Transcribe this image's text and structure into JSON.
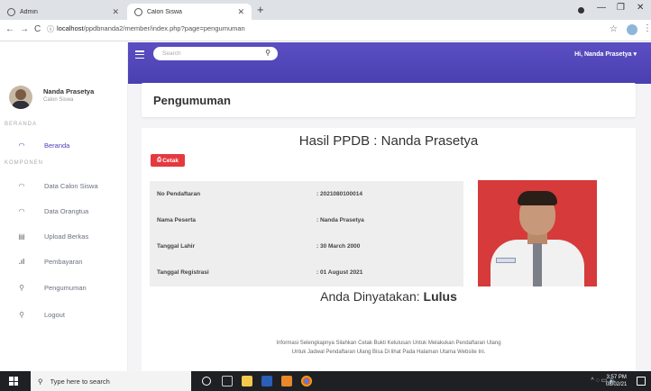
{
  "browser": {
    "tabs": [
      {
        "title": "Admin",
        "active": false
      },
      {
        "title": "Calon Siswa",
        "active": true
      }
    ],
    "url_host": "localhost",
    "url_path": "/ppdbnanda2/member/index.php?page=pengumuman"
  },
  "sidebar": {
    "user_name": "Nanda Prasetya",
    "user_role": "Calon Siswa",
    "section_beranda": "BERANDA",
    "section_komponen": "KOMPONEN",
    "items": [
      {
        "label": "Beranda",
        "icon": "dashboard-icon",
        "active": true
      },
      {
        "label": "Data Calon Siswa",
        "icon": "gauge-icon",
        "active": false
      },
      {
        "label": "Data Orangtua",
        "icon": "gauge-icon",
        "active": false
      },
      {
        "label": "Upload Berkas",
        "icon": "document-icon",
        "active": false
      },
      {
        "label": "Pembayaran",
        "icon": "bar-chart-icon",
        "active": false
      },
      {
        "label": "Pengumuman",
        "icon": "pin-icon",
        "active": false
      },
      {
        "label": "Logout",
        "icon": "pin-icon",
        "active": false
      }
    ]
  },
  "topnav": {
    "search_placeholder": "Search",
    "greeting": "Hi, Nanda Prasetya",
    "accent_color": "#4e3fb8"
  },
  "page": {
    "title": "Pengumuman",
    "result_title": "Hasil PPDB : Nanda Prasetya",
    "print_button": "Cetak",
    "fields": [
      {
        "label": "No Pendaftaran",
        "value": ": 2021080100014"
      },
      {
        "label": "Nama Peserta",
        "value": ": Nanda Prasetya"
      },
      {
        "label": "Tanggal Lahir",
        "value": ": 30 March 2000"
      },
      {
        "label": "Tanggal Registrasi",
        "value": ": 01 August 2021"
      }
    ],
    "verdict_prefix": "Anda Dinyatakan: ",
    "verdict_status": "Lulus",
    "note_line1": "Informasi Selengkapnya Silahkan Cetak Bukti Kelulusan Untuk Melakukan Pendaftaran Ulang",
    "note_line2": "Untuk Jadwal Pendaftaran Ulang Bisa Di lihat Pada Halaman Utama Website Ini."
  },
  "taskbar": {
    "search_placeholder": "Type here to search",
    "time": "3:57 PM",
    "date": "08/02/21"
  }
}
